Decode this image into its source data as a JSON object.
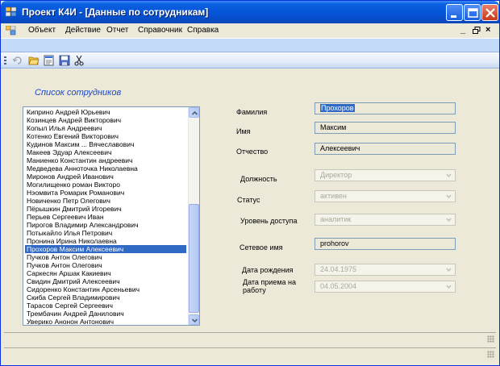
{
  "window": {
    "title": "Проект К4И - [Данные по сотрудникам]"
  },
  "menu": {
    "items": [
      "Объект",
      "Действие",
      "Отчет",
      "Справочник",
      "Справка"
    ],
    "mdi_minimize": "_",
    "mdi_restore": "🗗",
    "mdi_close": "×"
  },
  "employee_list": {
    "title": "Список сотрудников",
    "items": [
      "Киприно Андрей Юрьевич",
      "Козинцев Андрей Викторович",
      "Копыл Илья Андреевич",
      "Котенко Евгений Викторович",
      "Кудинов Максим ... Вячеславович",
      "Макеев Эдуар Алексеевич",
      "Маниенко Константин андреевич",
      "Медведева Анноточка Николаевна",
      "Миронов Андрей Иванович",
      "Могилищенко роман Викторо",
      "Нэомвита Ромарик Романович",
      "Новиченко Петр Олегович",
      "Пёрышкин Дмитрий Игоревич",
      "Перьев Сергеевич Иван",
      "Пирогов Владимир Александрович",
      "Потыкайло  Илья Петрович",
      "Пронина Ирина  Николаевна",
      "Прохоров Максим Алексеевич",
      "Пучков Антон Олегович",
      "Пучков Антон Олегович",
      "Саркесян Аршак Какиевич",
      "Свидин Дмитрий Алексеевич",
      "Сидоренко Константин Арсеньевич",
      "Скиба Сергей Владимирович",
      "Тарасов Сергей  Сергеевич",
      "Трембачин Андрей Данилович",
      "Уверико Анонон Антонович"
    ],
    "selected_index": 17
  },
  "form": {
    "surname_label": "Фамилия",
    "surname_value": "Прохоров",
    "name_label": "Имя",
    "name_value": "Максим",
    "patronymic_label": "Отчество",
    "patronymic_value": "Алексеевич",
    "position_label": "Должность",
    "position_value": "Директор",
    "status_label": "Статус",
    "status_value": "активен",
    "access_label": "Уровень доступа",
    "access_value": "аналитик",
    "network_label": "Сетевое имя",
    "network_value": "prohorov",
    "birth_label": "Дата рождения",
    "birth_value": "24.04.1975",
    "hire_label": "Дата приема на работу",
    "hire_value": "04.05.2004"
  },
  "icons": {
    "app": "app-icon",
    "tools": [
      "undo-icon",
      "open-folder-icon",
      "edit-form-icon",
      "save-icon",
      "cut-icon"
    ]
  }
}
